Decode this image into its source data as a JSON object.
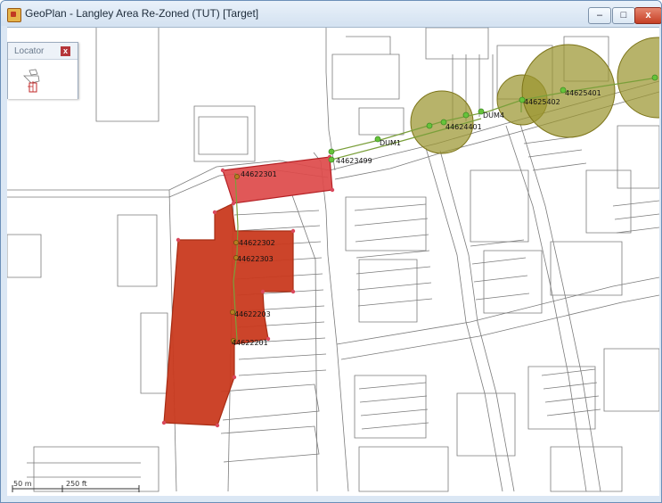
{
  "window": {
    "title": "GeoPlan - Langley Area Re-Zoned (TUT) [Target]",
    "minimize_label": "–",
    "maximize_label": "□",
    "close_label": "x"
  },
  "locator": {
    "title": "Locator",
    "close_label": "x"
  },
  "map": {
    "labels": {
      "l44622301": "44622301",
      "l44622302": "44622302",
      "l44622303": "44622303",
      "l44622203": "44622203",
      "l44622201": "44622201",
      "l44623499": "44623499",
      "dum1": "DUM1",
      "l44624401": "44624401",
      "dum4": "DUM4",
      "l44625402": "44625402",
      "l44625401": "44625401"
    },
    "scale": {
      "left": "50 m",
      "right": "250 ft"
    },
    "colors": {
      "zone_dark": "#c93a1f",
      "zone_light": "#dd4a4a",
      "circle_fill": "#9b9530",
      "node_green": "#66c33a"
    }
  }
}
